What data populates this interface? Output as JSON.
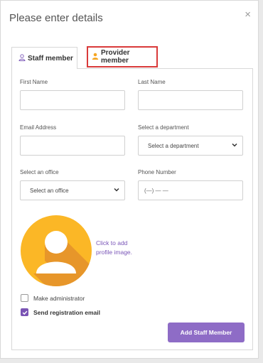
{
  "modal": {
    "title": "Please enter details",
    "close_glyph": "×"
  },
  "tabs": [
    {
      "label": "Staff member",
      "icon": "person-outline-icon",
      "icon_color": "#7b57b8",
      "active": true
    },
    {
      "label": "Provider member",
      "icon": "person-filled-icon",
      "icon_color": "#f5a623",
      "active": false,
      "highlighted": true,
      "highlight_color": "#d93a3a"
    }
  ],
  "form": {
    "first_name": {
      "label": "First Name",
      "value": ""
    },
    "last_name": {
      "label": "Last Name",
      "value": ""
    },
    "email": {
      "label": "Email Address",
      "value": ""
    },
    "department": {
      "label": "Select a department",
      "selected": "Select a department"
    },
    "office": {
      "label": "Select an office",
      "selected": "Select an office"
    },
    "phone": {
      "label": "Phone Number",
      "placeholder": "(—) — —"
    }
  },
  "profile_image": {
    "line1": "Click to add",
    "line2": "profile image.",
    "icon": "avatar-placeholder-icon",
    "circle_color": "#fbb726",
    "shadow_color": "#e7962a"
  },
  "checkboxes": {
    "administrator": {
      "label": "Make administrator",
      "checked": false
    },
    "registration_email": {
      "label": "Send registration email",
      "checked": true
    }
  },
  "actions": {
    "submit_label": "Add Staff Member"
  },
  "colors": {
    "accent": "#8e6cc6",
    "link": "#7b57b8"
  }
}
